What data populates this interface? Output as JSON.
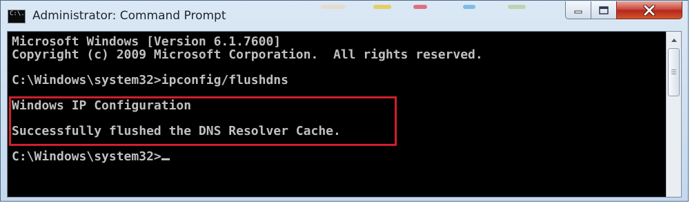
{
  "window": {
    "title": "Administrator: Command Prompt",
    "icon_name": "cmd-window-icon",
    "icon_text": "C:\\."
  },
  "caption_buttons": [
    {
      "name": "minimize-button",
      "icon": "minimize-icon"
    },
    {
      "name": "maximize-button",
      "icon": "maximize-icon"
    },
    {
      "name": "close-button",
      "icon": "close-icon"
    }
  ],
  "console": {
    "lines": [
      "Microsoft Windows [Version 6.1.7600]",
      "Copyright (c) 2009 Microsoft Corporation.  All rights reserved.",
      "",
      "C:\\Windows\\system32>ipconfig/flushdns",
      "",
      "Windows IP Configuration",
      "",
      "Successfully flushed the DNS Resolver Cache.",
      "",
      "C:\\Windows\\system32>"
    ],
    "text_color": "#c0c0c0",
    "background": "#000000"
  },
  "highlight": {
    "color": "#d31f2b"
  },
  "scrollbar": {
    "visible": true
  }
}
